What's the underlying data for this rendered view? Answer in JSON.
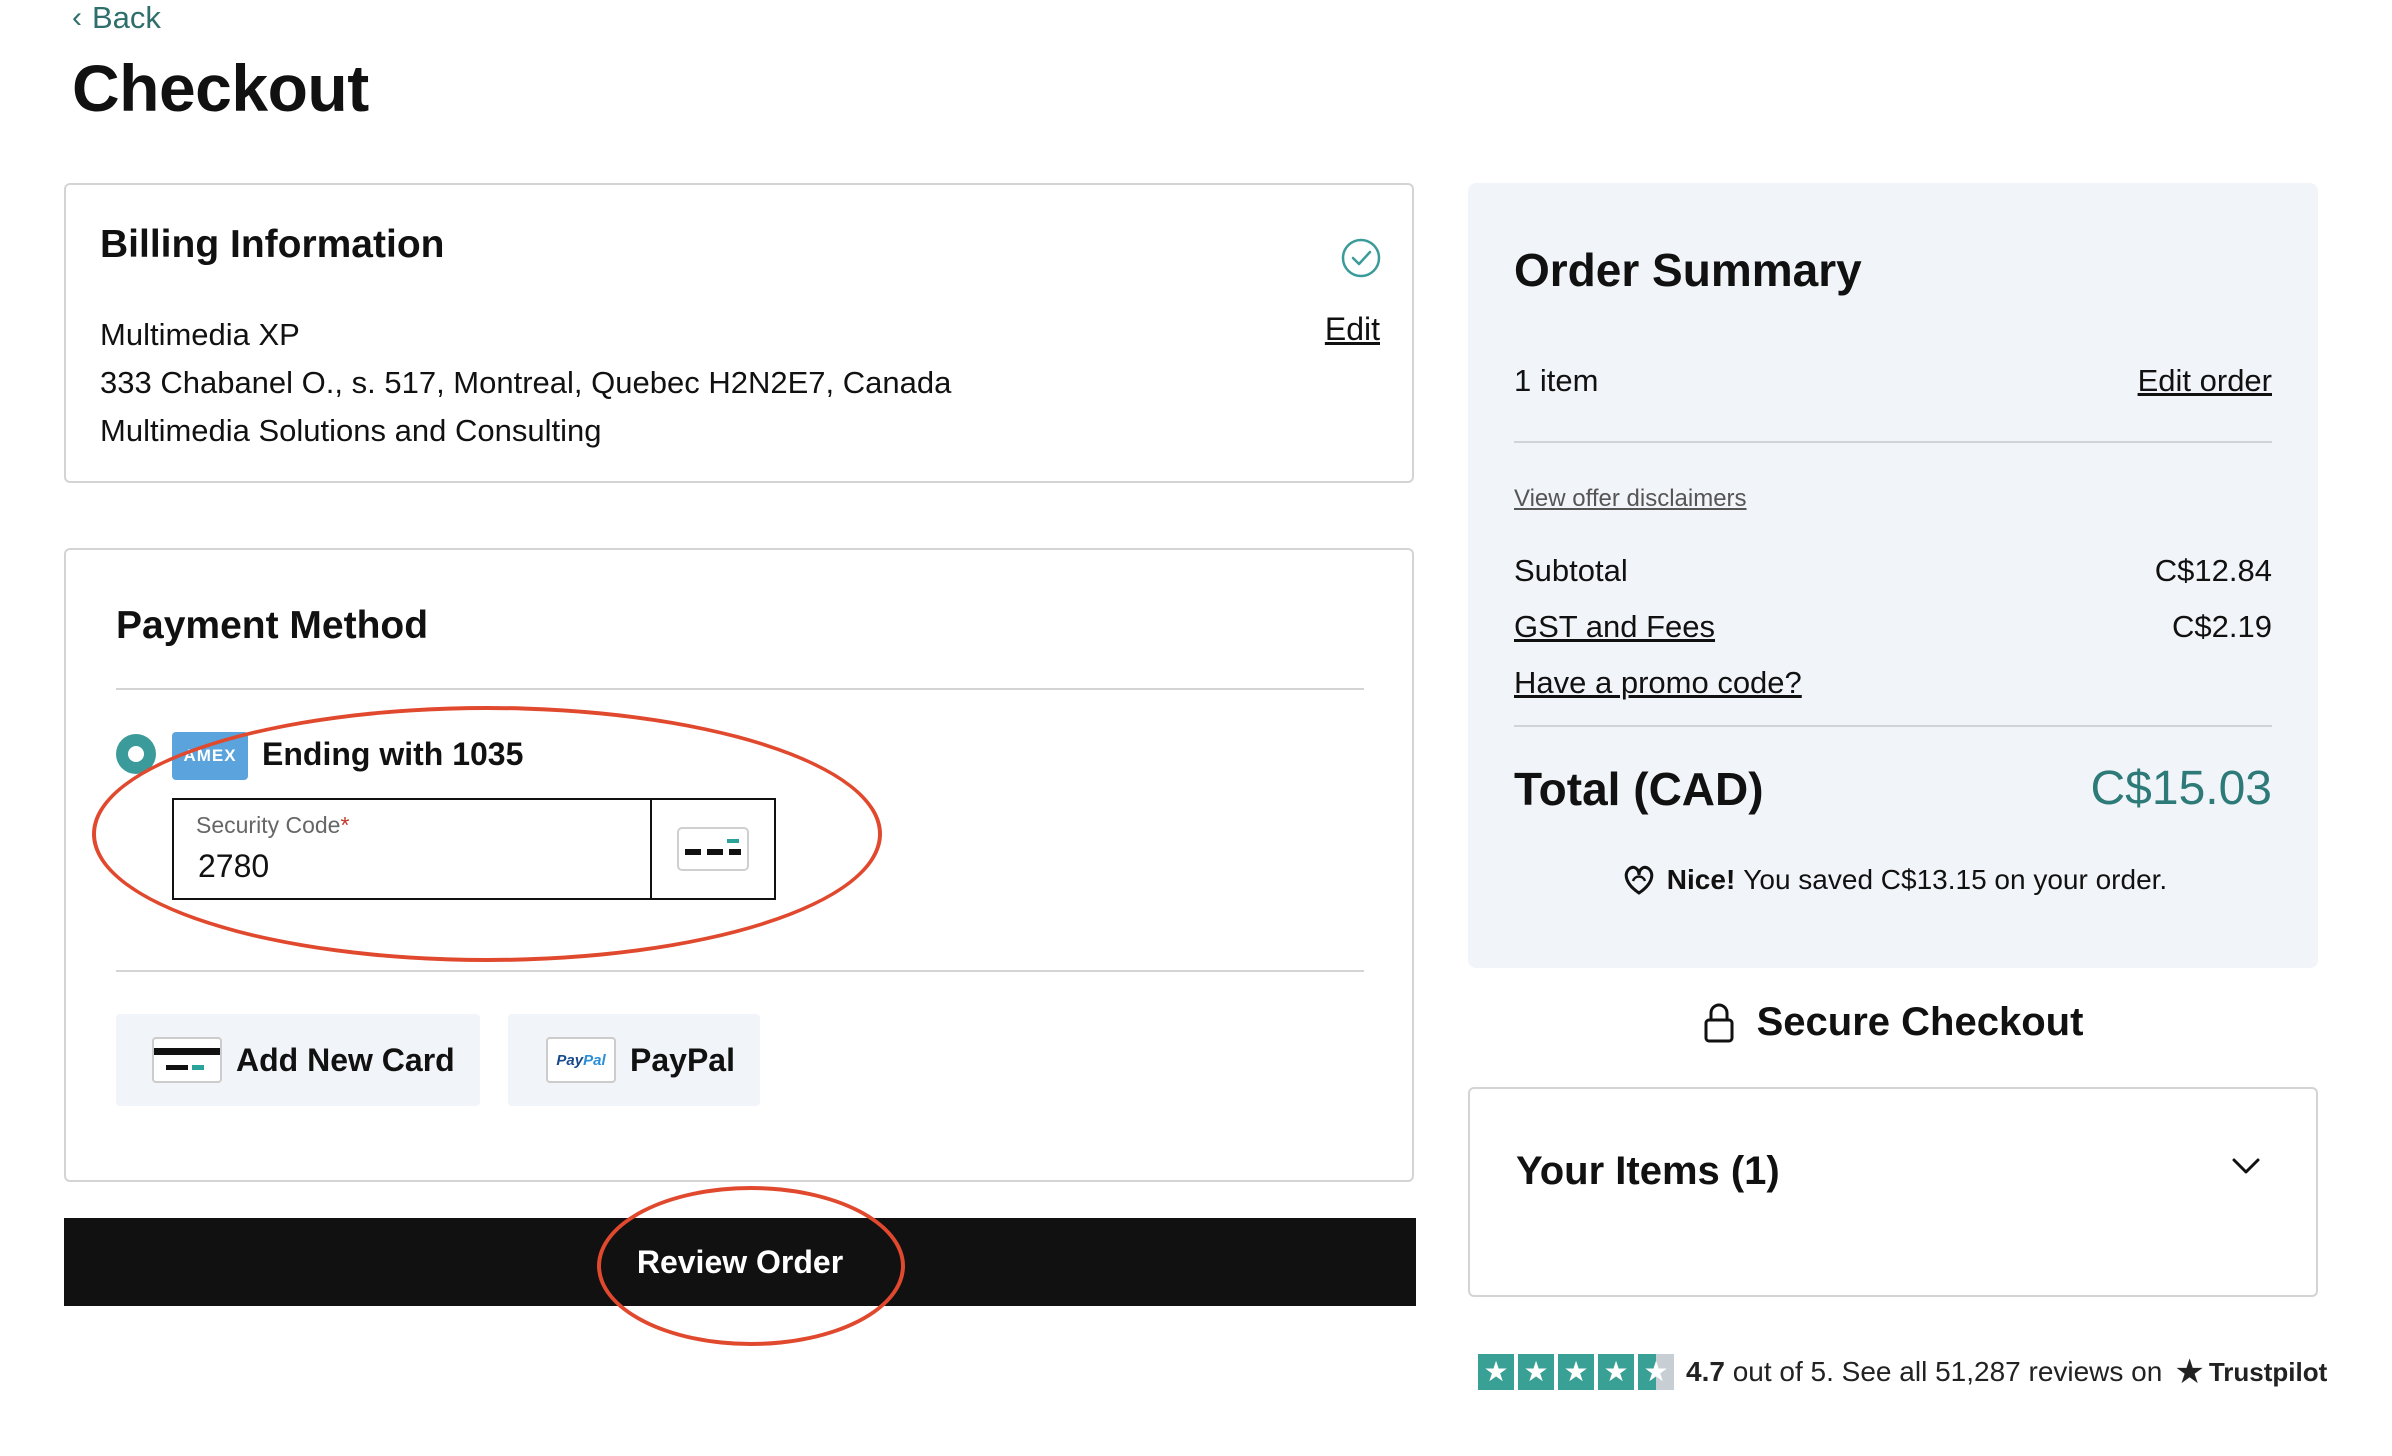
{
  "nav": {
    "back_label": "Back"
  },
  "page": {
    "title": "Checkout"
  },
  "billing": {
    "heading": "Billing Information",
    "edit_label": "Edit",
    "name": "Multimedia XP",
    "address": "333 Chabanel O., s. 517, Montreal, Quebec H2N2E7, Canada",
    "company": "Multimedia Solutions and Consulting"
  },
  "payment": {
    "heading": "Payment Method",
    "card_brand": "AMEX",
    "card_ending": "Ending with 1035",
    "security_label": "Security Code",
    "security_required_mark": "*",
    "security_value": "2780",
    "add_card_label": "Add New Card",
    "paypal_label": "PayPal",
    "paypal_logo_a": "Pay",
    "paypal_logo_b": "Pal"
  },
  "review_button": "Review Order",
  "summary": {
    "heading": "Order Summary",
    "item_count": "1 item",
    "edit_order": "Edit order",
    "disclaimers": "View offer disclaimers",
    "subtotal_label": "Subtotal",
    "subtotal_value": "C$12.84",
    "fees_label": "GST and Fees",
    "fees_value": "C$2.19",
    "promo": "Have a promo code?",
    "total_label": "Total (CAD)",
    "total_value": "C$15.03",
    "saved_prefix": "Nice!",
    "saved_text": "You saved C$13.15 on your order."
  },
  "secure_checkout": "Secure Checkout",
  "items_panel": {
    "heading": "Your Items (1)"
  },
  "trustpilot": {
    "rating": "4.7",
    "text": "out of 5. See all 51,287 reviews on",
    "brand": "Trustpilot",
    "star_fill": 4.5
  },
  "colors": {
    "accent_teal": "#2d7a78",
    "radio_teal": "#3a9b9a",
    "annotation_red": "#e0492e",
    "button_black": "#111111"
  }
}
